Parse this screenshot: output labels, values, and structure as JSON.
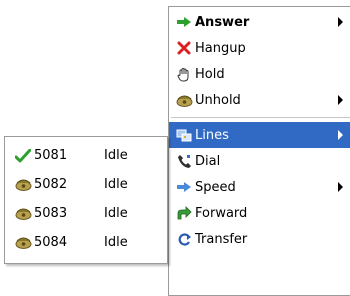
{
  "main_menu": {
    "items": [
      {
        "label": "Answer",
        "icon": "answer-arrow-icon",
        "bold": true,
        "submenu": true
      },
      {
        "label": "Hangup",
        "icon": "hangup-x-icon",
        "submenu": false
      },
      {
        "label": "Hold",
        "icon": "hold-hand-icon",
        "submenu": false
      },
      {
        "label": "Unhold",
        "icon": "unhold-phone-icon",
        "submenu": true
      },
      {
        "label": "Lines",
        "icon": "lines-icon",
        "submenu": true,
        "selected": true
      },
      {
        "label": "Dial",
        "icon": "dial-handset-icon",
        "submenu": false
      },
      {
        "label": "Speed",
        "icon": "speed-arrow-icon",
        "submenu": true
      },
      {
        "label": "Forward",
        "icon": "forward-icon",
        "submenu": false
      },
      {
        "label": "Transfer",
        "icon": "transfer-icon",
        "submenu": false
      }
    ]
  },
  "lines_menu": {
    "items": [
      {
        "number": "5081",
        "status": "Idle",
        "icon": "checkmark-icon"
      },
      {
        "number": "5082",
        "status": "Idle",
        "icon": "phone-icon"
      },
      {
        "number": "5083",
        "status": "Idle",
        "icon": "phone-icon"
      },
      {
        "number": "5084",
        "status": "Idle",
        "icon": "phone-icon"
      }
    ]
  },
  "colors": {
    "selection": "#316ac5",
    "answer_green": "#2ea02e",
    "hangup_red": "#e02020"
  }
}
